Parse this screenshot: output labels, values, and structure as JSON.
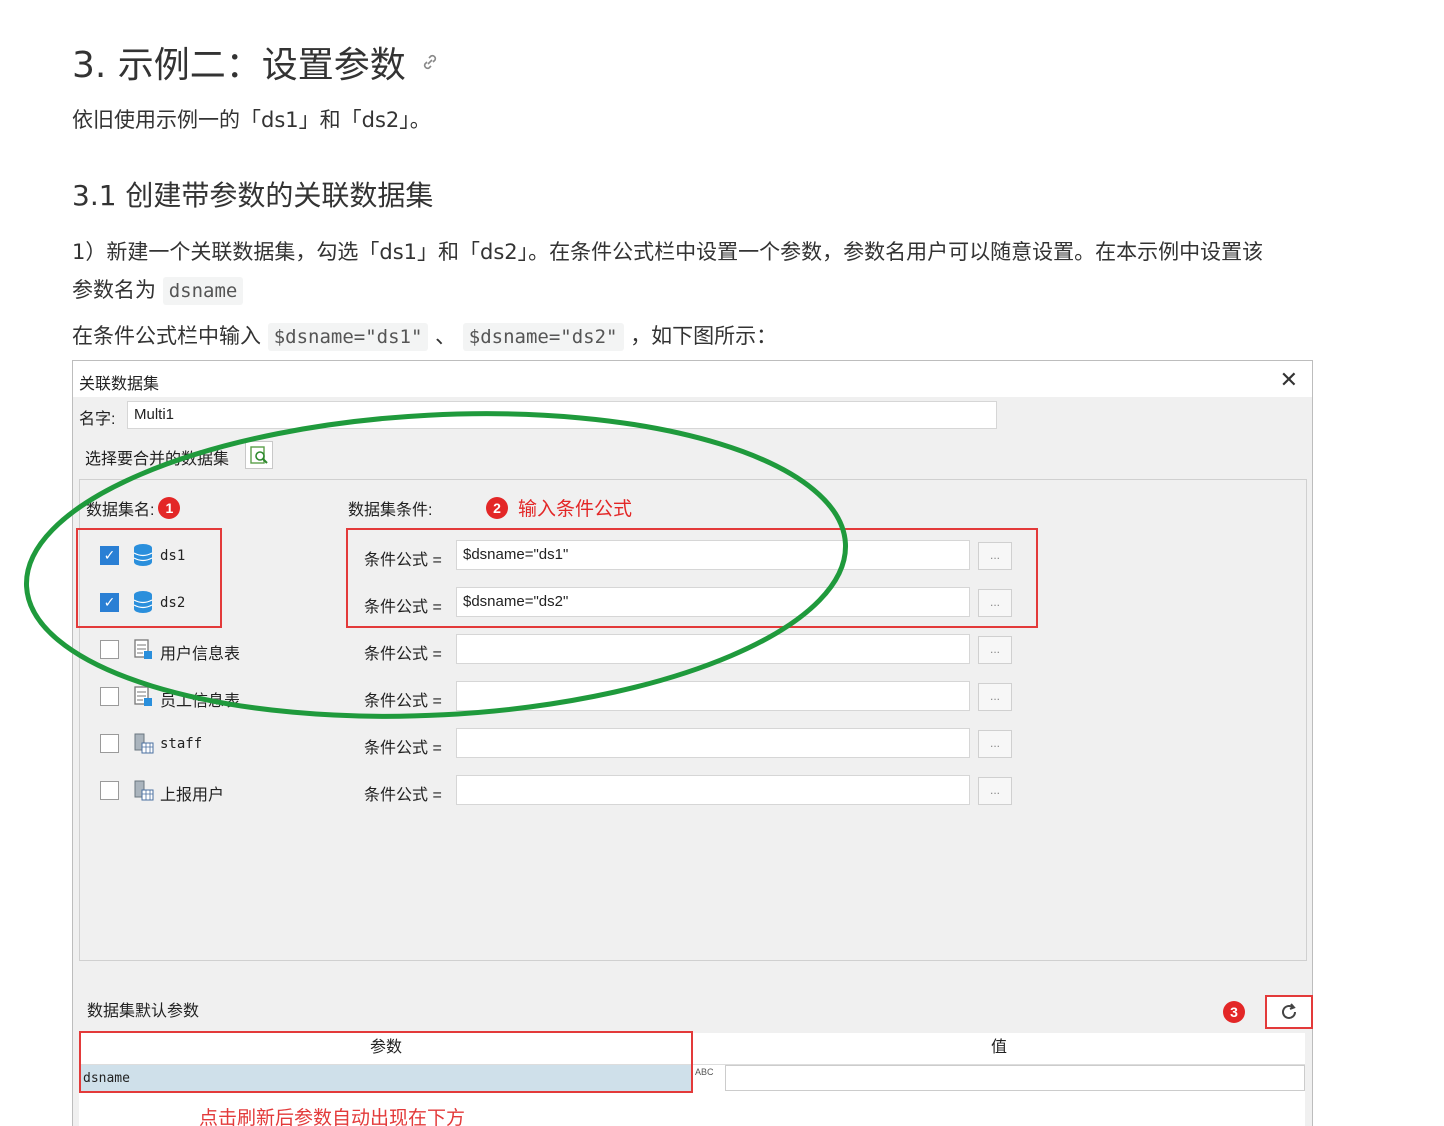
{
  "doc": {
    "heading": "3. 示例二：设置参数",
    "intro": "依旧使用示例一的「ds1」和「ds2」。",
    "subheading": "3.1 创建带参数的关联数据集",
    "step1_line1": "1）新建一个关联数据集，勾选「ds1」和「ds2」。在条件公式栏中设置一个参数，参数名用户可以随意设置。在本示例中设置该",
    "step1_line2_prefix": "参数名为",
    "step1_code": "dsname",
    "line3_prefix": "在条件公式栏中输入",
    "code1": "$dsname=\"ds1\"",
    "sep": "、",
    "code2": "$dsname=\"ds2\"",
    "line3_suffix": "，如下图所示："
  },
  "dialog": {
    "title": "关联数据集",
    "close": "✕",
    "name_label": "名字:",
    "name_value": "Multi1",
    "select_label": "选择要合并的数据集",
    "col_dataset": "数据集名:",
    "col_condition": "数据集条件:",
    "badge1": "1",
    "badge2": "2",
    "note2": "输入条件公式",
    "cond_label": "条件公式 =",
    "more_btn": "...",
    "rows": [
      {
        "name": "ds1",
        "checked": true,
        "icon": "database-icon",
        "value": "$dsname=\"ds1\""
      },
      {
        "name": "ds2",
        "checked": true,
        "icon": "database-icon",
        "value": "$dsname=\"ds2\""
      },
      {
        "name": "用户信息表",
        "checked": false,
        "icon": "table-doc-icon",
        "value": ""
      },
      {
        "name": "员工信息表",
        "checked": false,
        "icon": "table-doc-icon",
        "value": ""
      },
      {
        "name": "staff",
        "checked": false,
        "icon": "server-table-icon",
        "value": ""
      },
      {
        "name": "上报用户",
        "checked": false,
        "icon": "server-table-icon",
        "value": ""
      }
    ],
    "params_label": "数据集默认参数",
    "badge3": "3",
    "col_param": "参数",
    "col_value": "值",
    "param_name": "dsname",
    "abc": "ABC",
    "note3": "点击刷新后参数自动出现在下方"
  },
  "colors": {
    "accent_red": "#e33a3a",
    "highlight_green": "#1f9a3c",
    "check_blue": "#2a7fd4"
  }
}
